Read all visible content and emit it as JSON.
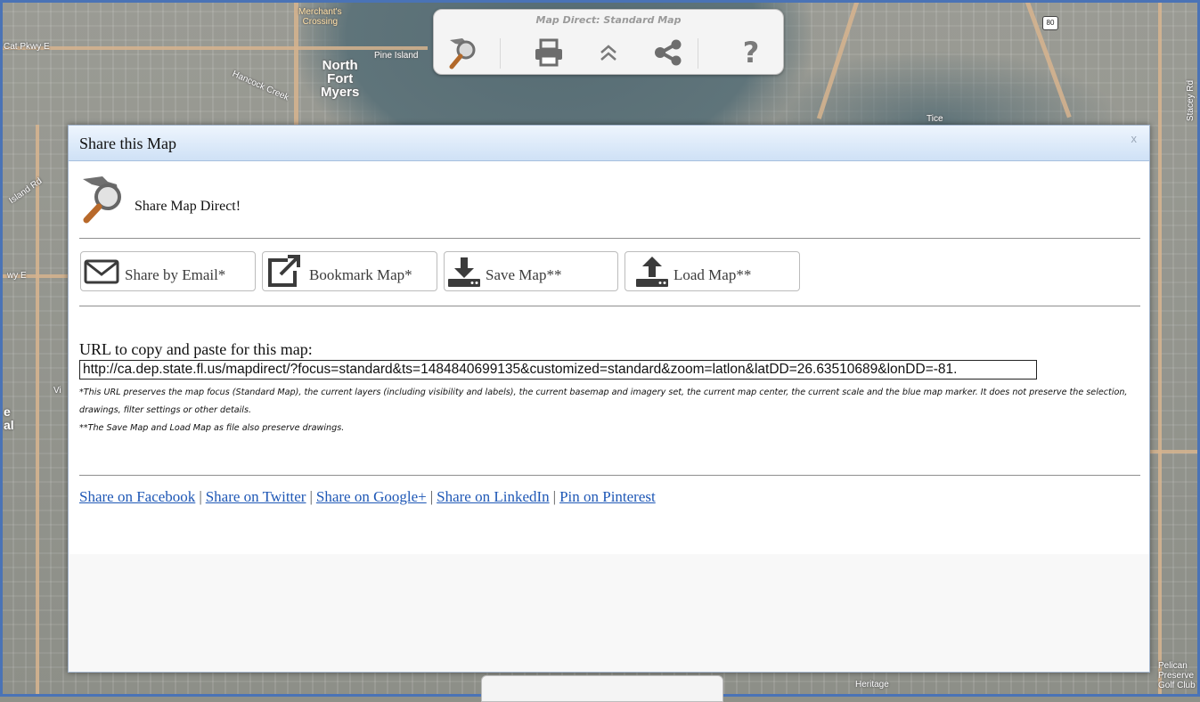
{
  "map": {
    "labels": {
      "pkwy_e_top": "Cat Pkwy E",
      "merchants_crossing": "Merchant's\nCrossing",
      "pine_island": "Pine Island",
      "north_fort_myers": "North\nFort\nMyers",
      "hancock_creek": "Hancock Creek",
      "tice": "Tice",
      "stacey_rd": "Stacey Rd",
      "island_rd": "Island Rd",
      "pkwy_e_mid": "wy E",
      "heritage": "Heritage",
      "pelican": "Pelican\nPreserve\nGolf Club",
      "hwy_80": "80",
      "via": "Vi",
      "edge_e": "e",
      "edge_al": "al"
    }
  },
  "toolbar": {
    "title": "Map Direct: Standard Map",
    "buttons": {
      "logo": "map-direct-logo-icon",
      "print": "printer-icon",
      "collapse": "double-chevron-up-icon",
      "share": "share-icon",
      "help": "?"
    }
  },
  "dialog": {
    "title": "Share this Map",
    "close": "x",
    "brand_text": "Share Map Direct!",
    "buttons": {
      "email": "Share by Email*",
      "bookmark": "Bookmark Map*",
      "save": "Save Map**",
      "load": "Load Map**"
    },
    "url_label": "URL to copy and paste for this map:",
    "url_value": "http://ca.dep.state.fl.us/mapdirect/?focus=standard&ts=1484840699135&customized=standard&zoom=latlon&latDD=26.63510689&lonDD=-81.",
    "note_1": "*This URL preserves the map focus (Standard Map), the current layers (including visibility and labels), the current basemap and imagery set, the current map center, the current scale and the blue map marker. It does not preserve the selection, drawings, filter settings or other details.",
    "note_2": "**The Save Map and Load Map as file also preserve drawings.",
    "social": {
      "facebook": "Share on Facebook",
      "twitter": "Share on Twitter",
      "google": "Share on Google+",
      "linkedin": "Share on LinkedIn",
      "pinterest": "Pin on Pinterest",
      "separator": "|"
    }
  },
  "colors": {
    "dialog_border": "#a5b7cf",
    "link": "#1f58b6",
    "map_frame": "#4a73b6"
  }
}
